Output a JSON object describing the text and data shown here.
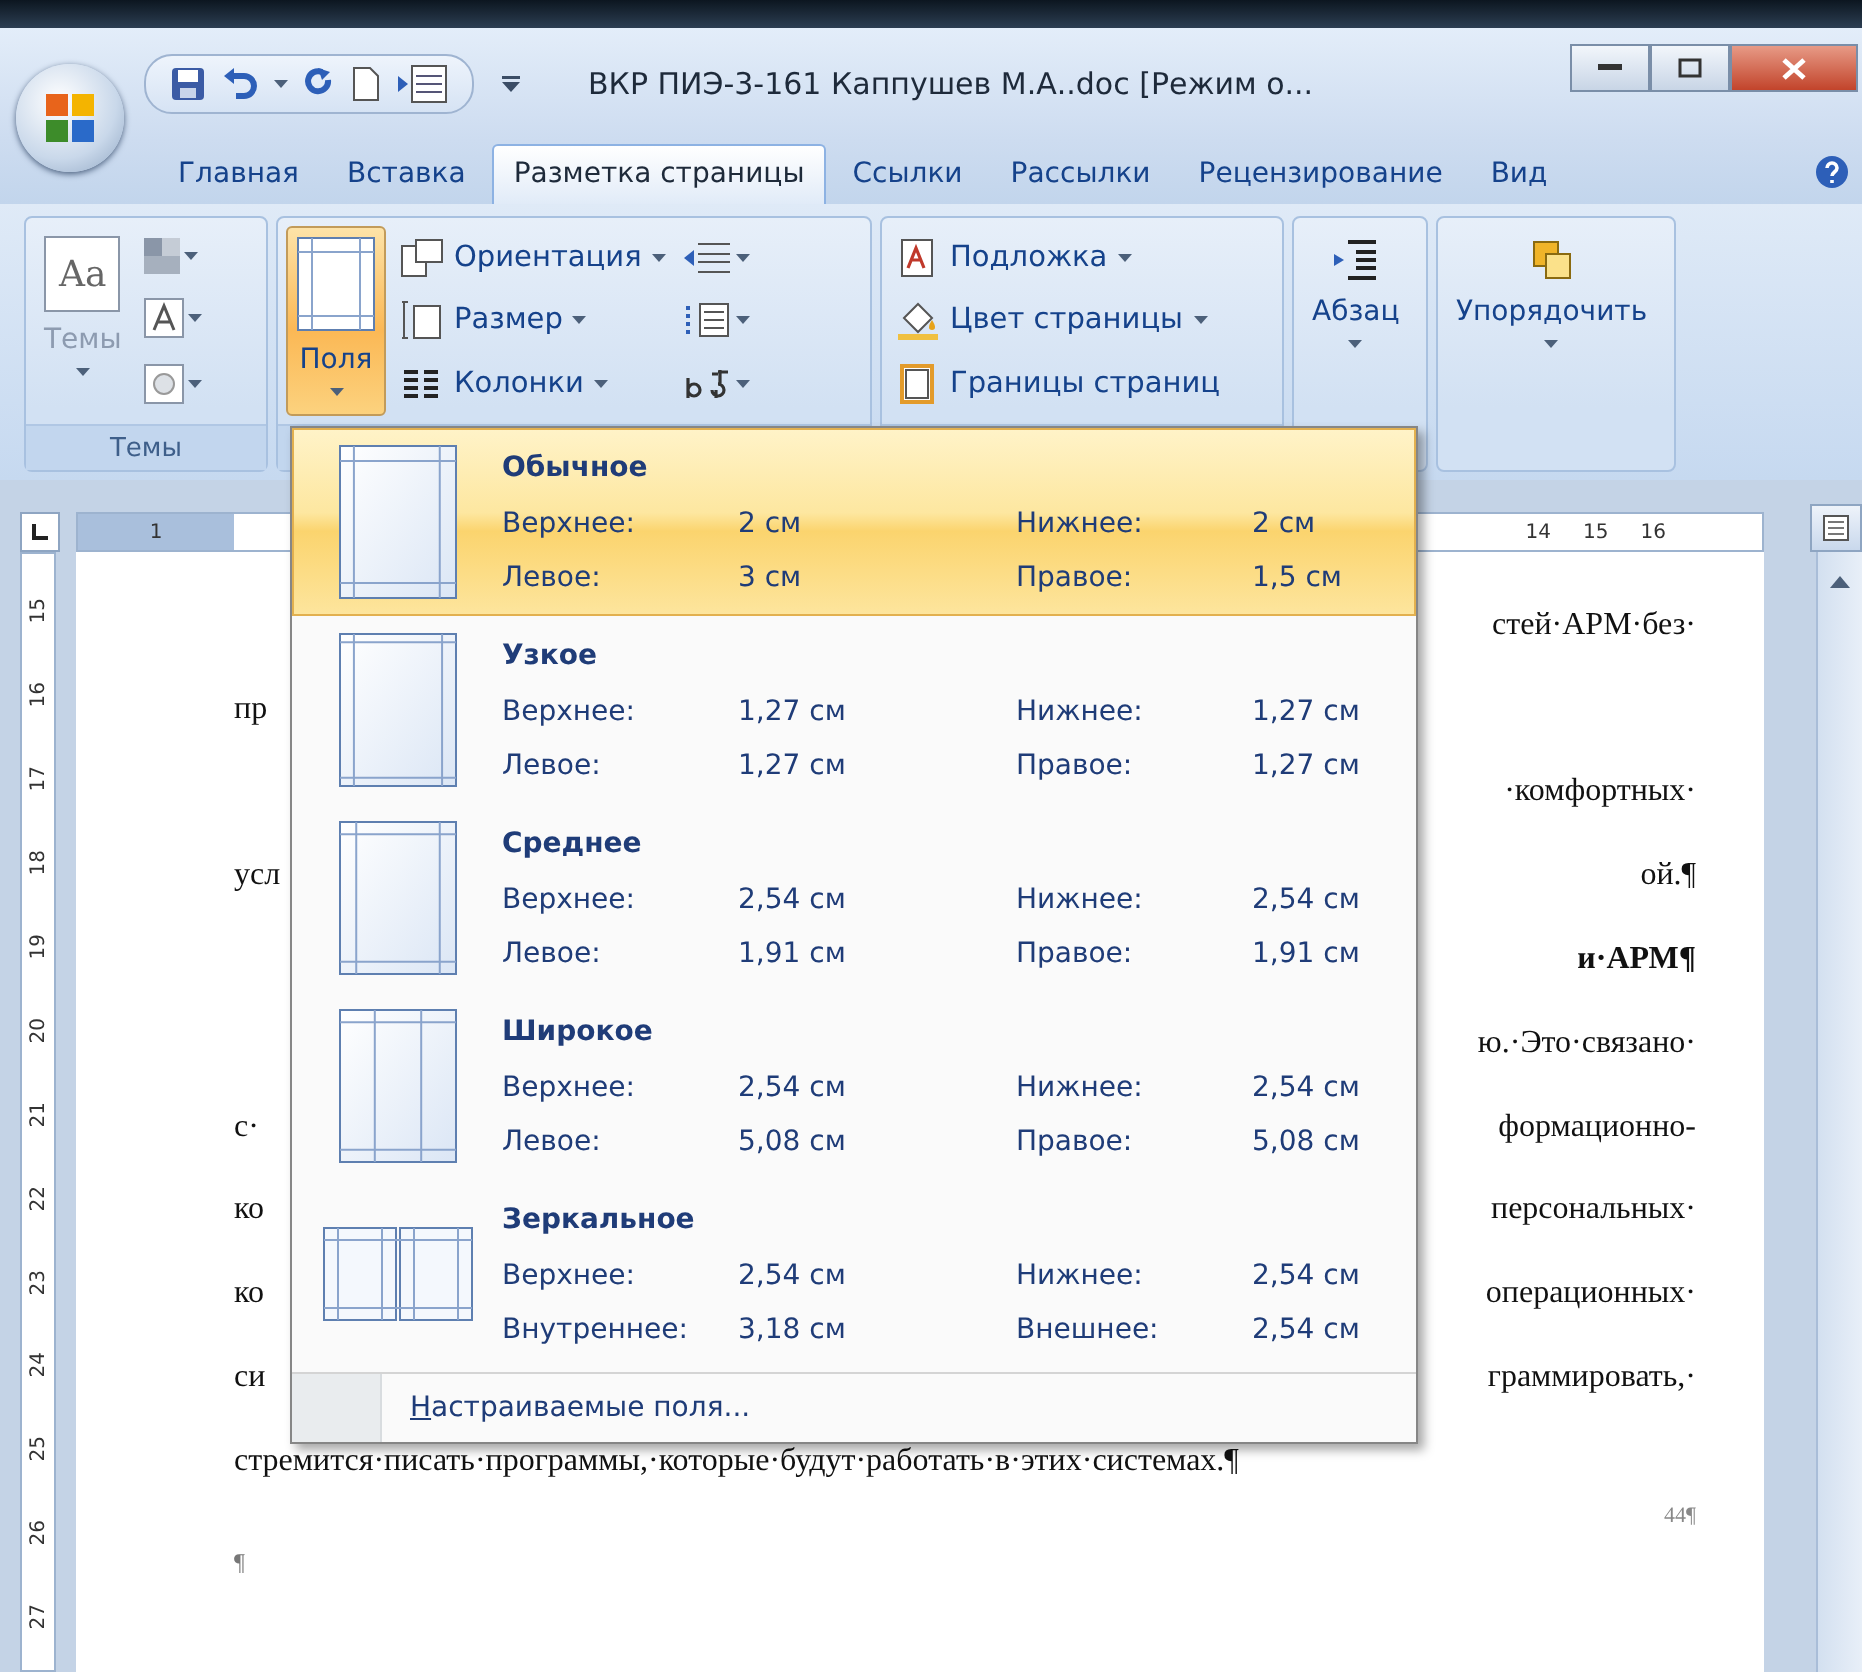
{
  "title_bar": {
    "title": "ВКР ПИЭ-3-161 Каппушев М.А..doc [Режим о..."
  },
  "tabs": [
    {
      "label": "Главная",
      "selected": false
    },
    {
      "label": "Вставка",
      "selected": false
    },
    {
      "label": "Разметка страницы",
      "selected": true
    },
    {
      "label": "Ссылки",
      "selected": false
    },
    {
      "label": "Рассылки",
      "selected": false
    },
    {
      "label": "Рецензирование",
      "selected": false
    },
    {
      "label": "Вид",
      "selected": false
    }
  ],
  "ribbon": {
    "themes_group": {
      "preview": "Aa",
      "button": "Темы",
      "label": "Темы"
    },
    "page_setup_group": {
      "margins_button": {
        "label": "Поля",
        "pressed": true
      },
      "commands": [
        "Ориентация",
        "Размер",
        "Колонки"
      ]
    },
    "page_background_group": {
      "commands": [
        "Подложка",
        "Цвет страницы",
        "Границы страниц"
      ]
    },
    "paragraph_button": "Абзац",
    "arrange_button": "Упорядочить"
  },
  "ruler": {
    "left_numbers": [
      "1"
    ],
    "right_numbers": [
      "14",
      "15",
      "16"
    ]
  },
  "vertical_ruler": {
    "numbers": [
      "15",
      "16",
      "17",
      "18",
      "19",
      "20",
      "21",
      "22",
      "23",
      "24",
      "25",
      "26",
      "27"
    ]
  },
  "document": {
    "lines": [
      {
        "right": "стей·АРМ·без·",
        "bold": false
      },
      {
        "left": "пр",
        "bold": false
      },
      {
        "right": "·комфортных·",
        "bold": false
      },
      {
        "left": "усл",
        "right": "ой.¶",
        "bold": false
      },
      {
        "right": "и·АРМ¶",
        "bold": true
      },
      {
        "right": "ю.·Это·связано·",
        "bold": false
      },
      {
        "left": "с·",
        "right": "формационно-",
        "bold": false
      },
      {
        "left": "ко",
        "right": "персональных·",
        "bold": false
      },
      {
        "left": "ко",
        "right": "операционных·",
        "bold": false
      },
      {
        "left": "си",
        "right": "граммировать,·",
        "bold": false
      },
      {
        "left": "стремится·писать·программы,·которые·будут·работать·в·этих·системах.¶",
        "bold": false
      }
    ],
    "page_number": "44¶",
    "trailing_mark": "¶"
  },
  "margins_menu": {
    "presets": [
      {
        "kind": "normal",
        "name": "Обычное",
        "selected": true,
        "top_label": "Верхнее:",
        "top": "2 см",
        "bottom_label": "Нижнее:",
        "bottom": "2 см",
        "left_label": "Левое:",
        "left": "3 см",
        "right_label": "Правое:",
        "right": "1,5 см"
      },
      {
        "kind": "narrow",
        "name": "Узкое",
        "selected": false,
        "top_label": "Верхнее:",
        "top": "1,27 см",
        "bottom_label": "Нижнее:",
        "bottom": "1,27 см",
        "left_label": "Левое:",
        "left": "1,27 см",
        "right_label": "Правое:",
        "right": "1,27 см"
      },
      {
        "kind": "moderate",
        "name": "Среднее",
        "selected": false,
        "top_label": "Верхнее:",
        "top": "2,54 см",
        "bottom_label": "Нижнее:",
        "bottom": "2,54 см",
        "left_label": "Левое:",
        "left": "1,91 см",
        "right_label": "Правое:",
        "right": "1,91 см"
      },
      {
        "kind": "wide",
        "name": "Широкое",
        "selected": false,
        "top_label": "Верхнее:",
        "top": "2,54 см",
        "bottom_label": "Нижнее:",
        "bottom": "2,54 см",
        "left_label": "Левое:",
        "left": "5,08 см",
        "right_label": "Правое:",
        "right": "5,08 см"
      },
      {
        "kind": "mirrored",
        "name": "Зеркальное",
        "selected": false,
        "top_label": "Верхнее:",
        "top": "2,54 см",
        "bottom_label": "Нижнее:",
        "bottom": "2,54 см",
        "left_label": "Внутреннее:",
        "left": "3,18 см",
        "right_label": "Внешнее:",
        "right": "2,54 см"
      }
    ],
    "custom": "Настраиваемые поля..."
  }
}
